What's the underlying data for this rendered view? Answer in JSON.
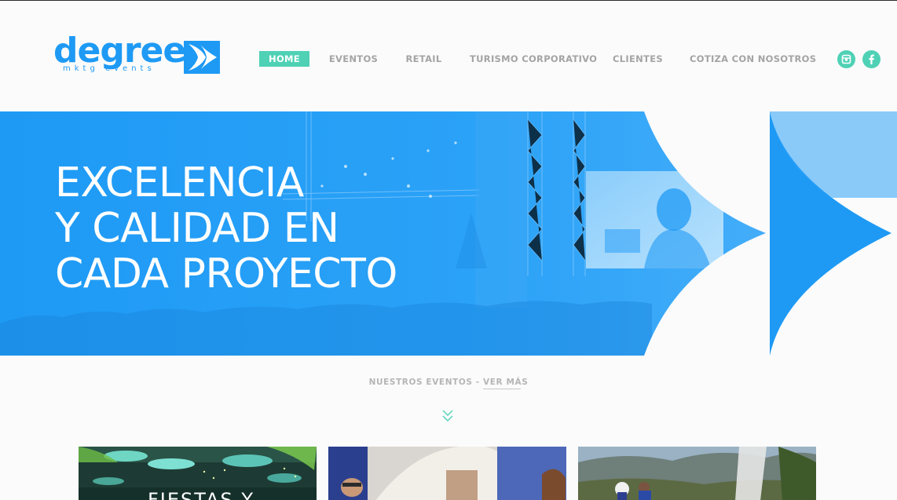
{
  "brand": {
    "name": "degree",
    "tagline": "mktg events",
    "color": "#1e9af5",
    "accent": "#4fd1b5"
  },
  "nav": {
    "items": [
      {
        "label": "HOME",
        "active": true
      },
      {
        "label": "EVENTOS",
        "active": false
      },
      {
        "label": "RETAIL",
        "active": false
      },
      {
        "label": "TURISMO CORPORATIVO",
        "active": false
      },
      {
        "label": "CLIENTES",
        "active": false
      },
      {
        "label": "COTIZA CON NOSOTROS",
        "active": false
      }
    ]
  },
  "social": {
    "icons": [
      "instagram-icon",
      "facebook-icon"
    ]
  },
  "hero": {
    "lines": [
      "EXCELENCIA",
      "Y CALIDAD EN",
      "CADA PROYECTO"
    ],
    "overlay_color": "#1e9af5"
  },
  "events": {
    "label": "NUESTROS EVENTOS -",
    "more": "VER MÁS",
    "icon": "double-chevron-down-icon"
  },
  "cards": [
    {
      "title": "FIESTAS Y"
    },
    {
      "title": ""
    },
    {
      "title": ""
    }
  ]
}
